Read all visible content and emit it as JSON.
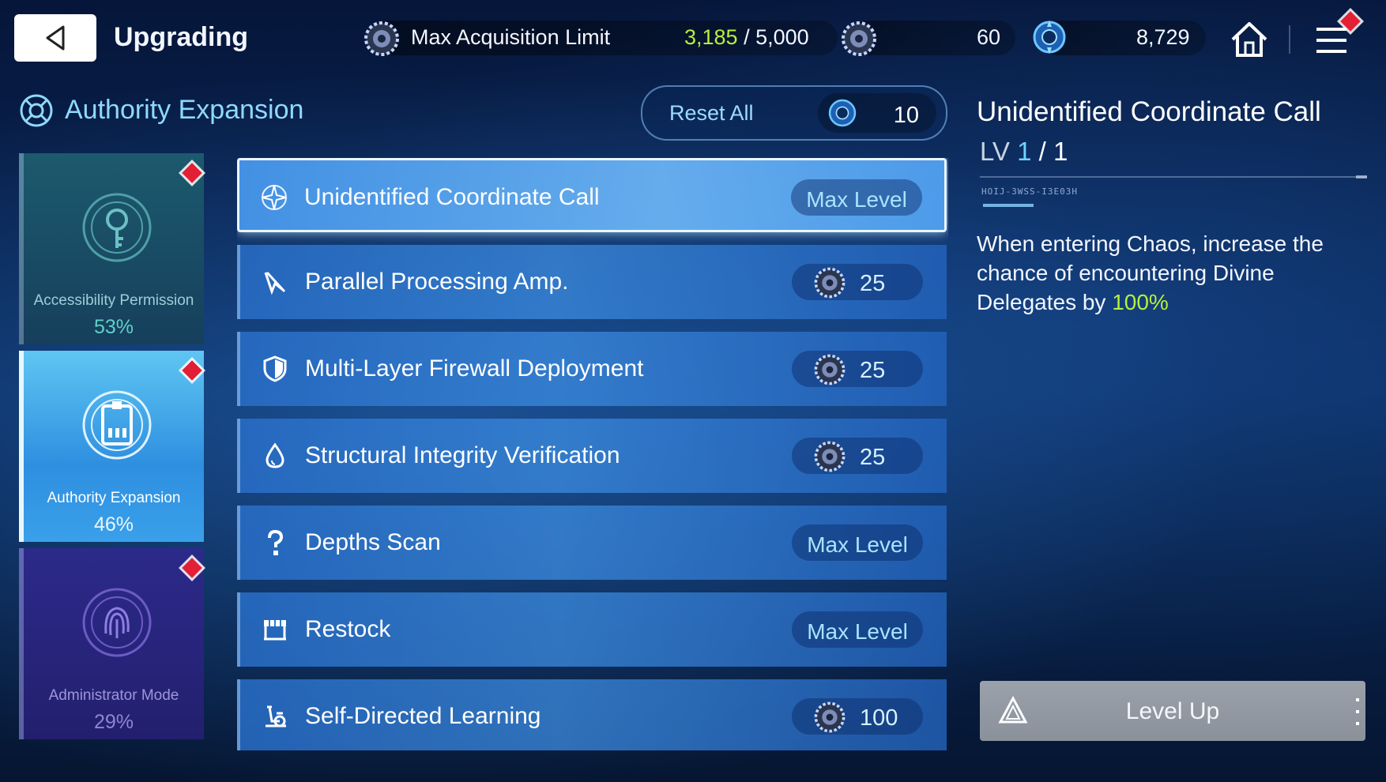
{
  "header": {
    "title": "Upgrading",
    "max_acquisition": {
      "label": "Max Acquisition Limit",
      "current": "3,185",
      "separator": "/",
      "max": "5,000"
    },
    "currency_gear": "60",
    "currency_orb": "8,729"
  },
  "section": {
    "title": "Authority Expansion",
    "reset_label": "Reset All",
    "reset_cost": "10"
  },
  "categories": [
    {
      "label": "Accessibility Permission",
      "pct": "53%",
      "icon": "key-icon"
    },
    {
      "label": "Authority Expansion",
      "pct": "46%",
      "icon": "id-badge-icon"
    },
    {
      "label": "Administrator Mode",
      "pct": "29%",
      "icon": "fingerprint-icon"
    }
  ],
  "upgrades": [
    {
      "name": "Unidentified Coordinate Call",
      "status": "Max Level",
      "icon": "compass-star-icon"
    },
    {
      "name": "Parallel Processing Amp.",
      "cost": "25",
      "icon": "cursor-slash-icon"
    },
    {
      "name": "Multi-Layer Firewall Deployment",
      "cost": "25",
      "icon": "shield-icon"
    },
    {
      "name": "Structural Integrity Verification",
      "cost": "25",
      "icon": "drop-icon"
    },
    {
      "name": "Depths Scan",
      "status": "Max Level",
      "icon": "question-icon"
    },
    {
      "name": "Restock",
      "status": "Max Level",
      "icon": "shop-icon"
    },
    {
      "name": "Self-Directed Learning",
      "cost": "100",
      "icon": "exercise-bike-icon"
    }
  ],
  "detail": {
    "title": "Unidentified Coordinate Call",
    "lv_prefix": "LV",
    "lv_current": "1",
    "lv_sep": "/",
    "lv_max": "1",
    "serial": "HOIJ-3WSS-I3E03H",
    "desc_text": "When entering Chaos, increase the chance of encountering Divine Delegates by",
    "desc_value": "100%",
    "button": "Level Up"
  },
  "colors": {
    "accent_green": "#b6f03c",
    "alert_red": "#ff2f46",
    "accent_blue": "#8fd9ff"
  }
}
